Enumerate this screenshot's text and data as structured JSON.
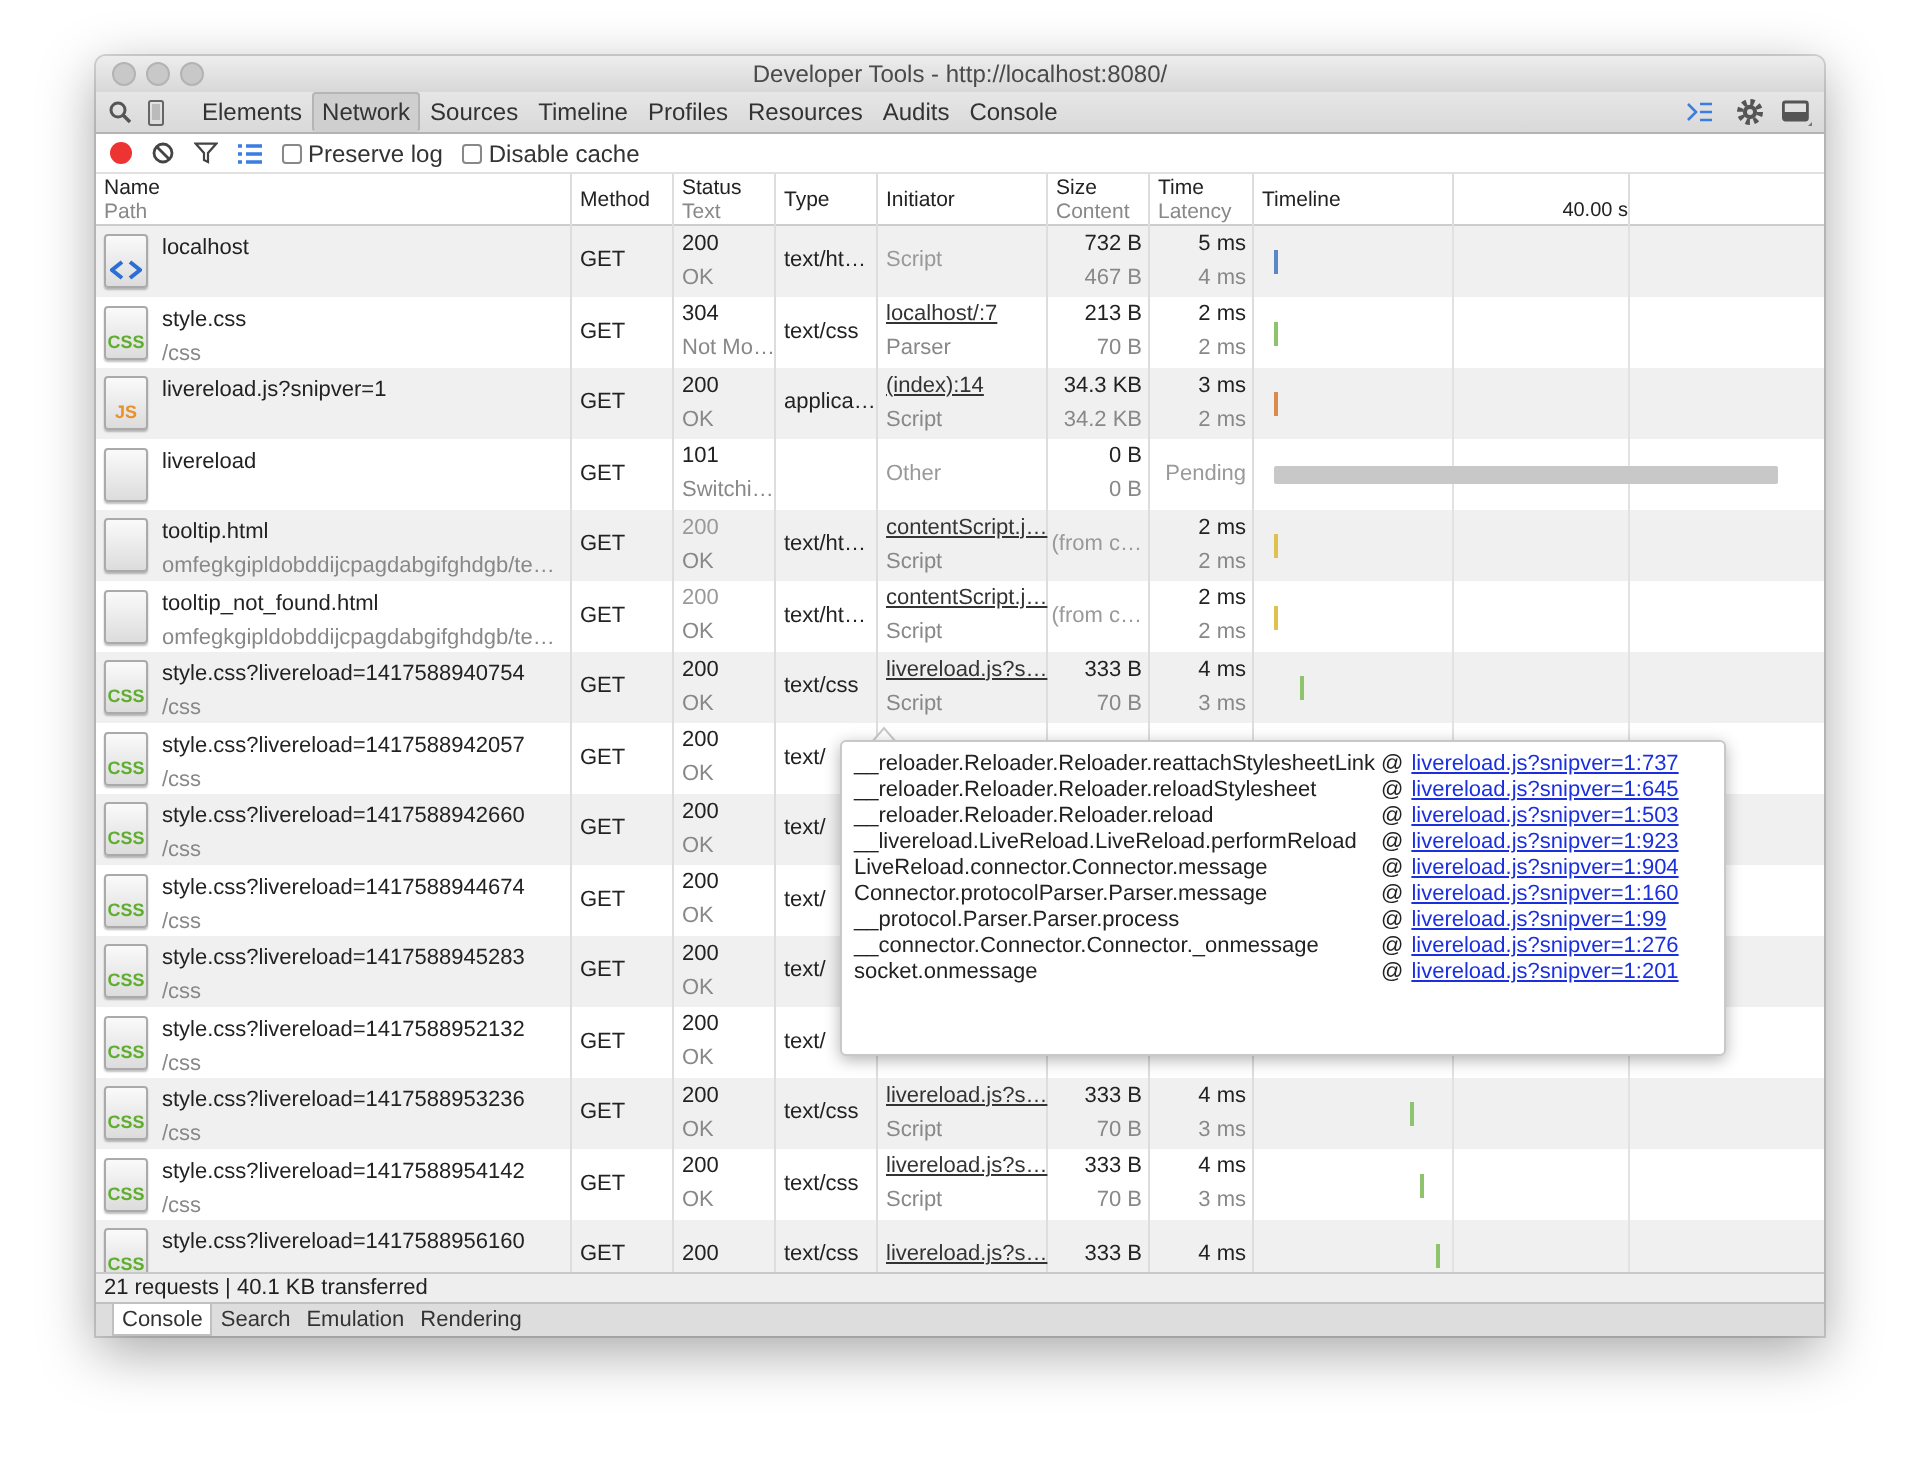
{
  "window": {
    "title": "Developer Tools - http://localhost:8080/"
  },
  "panel_tabs": [
    {
      "label": "Elements",
      "selected": false
    },
    {
      "label": "Network",
      "selected": true
    },
    {
      "label": "Sources",
      "selected": false
    },
    {
      "label": "Timeline",
      "selected": false
    },
    {
      "label": "Profiles",
      "selected": false
    },
    {
      "label": "Resources",
      "selected": false
    },
    {
      "label": "Audits",
      "selected": false
    },
    {
      "label": "Console",
      "selected": false
    }
  ],
  "toolbar": {
    "recording": true,
    "options": [
      {
        "label": "Preserve log",
        "checked": false
      },
      {
        "label": "Disable cache",
        "checked": false
      }
    ]
  },
  "columns": [
    {
      "top": "Name",
      "bottom": "Path"
    },
    {
      "top": "Method"
    },
    {
      "top": "Status",
      "bottom": "Text"
    },
    {
      "top": "Type"
    },
    {
      "top": "Initiator"
    },
    {
      "top": "Size",
      "bottom": "Content"
    },
    {
      "top": "Time",
      "bottom": "Latency"
    },
    {
      "top": "Timeline"
    }
  ],
  "timeline_scale": "40.00 s",
  "rows": [
    {
      "icon": {
        "kind": "html"
      },
      "name": "localhost",
      "method": "GET",
      "status": "200",
      "status_text": "OK",
      "from_cache": false,
      "type": "text/ht…",
      "initiator": "Script",
      "initiator_link": false,
      "size": "732 B",
      "content": "467 B",
      "time": "5 ms",
      "latency": "4 ms",
      "timeline": {
        "kind": "tick",
        "color": "#5b86c8"
      }
    },
    {
      "icon": {
        "kind": "css",
        "label": "CSS"
      },
      "name": "style.css",
      "path": "/css",
      "method": "GET",
      "status": "304",
      "status_text": "Not Mo…",
      "from_cache": false,
      "type": "text/css",
      "initiator": "localhost/:7",
      "initiator_link": true,
      "initiator_sub": "Parser",
      "size": "213 B",
      "content": "70 B",
      "time": "2 ms",
      "latency": "2 ms",
      "timeline": {
        "kind": "tick",
        "color": "#8fc46f"
      }
    },
    {
      "icon": {
        "kind": "js",
        "label": "JS"
      },
      "name": "livereload.js?snipver=1",
      "method": "GET",
      "status": "200",
      "status_text": "OK",
      "from_cache": false,
      "type": "applica…",
      "initiator": "(index):14",
      "initiator_link": true,
      "initiator_sub": "Script",
      "size": "34.3 KB",
      "content": "34.2 KB",
      "time": "3 ms",
      "latency": "2 ms",
      "timeline": {
        "kind": "tick",
        "color": "#d98c4e"
      }
    },
    {
      "icon": {
        "kind": "blank"
      },
      "name": "livereload",
      "method": "GET",
      "status": "101",
      "status_text": "Switchi…",
      "from_cache": false,
      "initiator": "Other",
      "initiator_link": false,
      "size": "0 B",
      "content": "0 B",
      "time": "Pending",
      "timeline": {
        "kind": "bar",
        "color": "#c8c8c8",
        "level": 0.92
      }
    },
    {
      "icon": {
        "kind": "blank"
      },
      "name": "tooltip.html",
      "path": "omfegkgipldobddijcpagdabgifghdgb/te…",
      "method": "GET",
      "status": "200",
      "status_text": "OK",
      "from_cache": true,
      "type": "text/ht…",
      "initiator": "contentScript.j…",
      "initiator_link": true,
      "initiator_sub": "Script",
      "size": "(from c…",
      "time": "2 ms",
      "latency": "2 ms",
      "timeline": {
        "kind": "tick",
        "color": "#e0c04e"
      }
    },
    {
      "icon": {
        "kind": "blank"
      },
      "name": "tooltip_not_found.html",
      "path": "omfegkgipldobddijcpagdabgifghdgb/te…",
      "method": "GET",
      "status": "200",
      "status_text": "OK",
      "from_cache": true,
      "type": "text/ht…",
      "initiator": "contentScript.j…",
      "initiator_link": true,
      "initiator_sub": "Script",
      "size": "(from c…",
      "time": "2 ms",
      "latency": "2 ms",
      "timeline": {
        "kind": "tick",
        "color": "#e0c04e"
      }
    },
    {
      "icon": {
        "kind": "css",
        "label": "CSS"
      },
      "name": "style.css?livereload=1417588940754",
      "path": "/css",
      "method": "GET",
      "status": "200",
      "status_text": "OK",
      "from_cache": false,
      "type": "text/css",
      "initiator": "livereload.js?s…",
      "initiator_link": true,
      "initiator_sub": "Script",
      "size": "333 B",
      "content": "70 B",
      "time": "4 ms",
      "latency": "3 ms",
      "timeline": {
        "kind": "tick",
        "color": "#8fc46f"
      }
    },
    {
      "icon": {
        "kind": "css",
        "label": "CSS"
      },
      "name": "style.css?livereload=1417588942057",
      "path": "/css",
      "method": "GET",
      "status": "200",
      "status_text": "OK",
      "from_cache": false,
      "type": "text/"
    },
    {
      "icon": {
        "kind": "css",
        "label": "CSS"
      },
      "name": "style.css?livereload=1417588942660",
      "path": "/css",
      "method": "GET",
      "status": "200",
      "status_text": "OK",
      "from_cache": false,
      "type": "text/"
    },
    {
      "icon": {
        "kind": "css",
        "label": "CSS"
      },
      "name": "style.css?livereload=1417588944674",
      "path": "/css",
      "method": "GET",
      "status": "200",
      "status_text": "OK",
      "from_cache": false,
      "type": "text/"
    },
    {
      "icon": {
        "kind": "css",
        "label": "CSS"
      },
      "name": "style.css?livereload=1417588945283",
      "path": "/css",
      "method": "GET",
      "status": "200",
      "status_text": "OK",
      "from_cache": false,
      "type": "text/"
    },
    {
      "icon": {
        "kind": "css",
        "label": "CSS"
      },
      "name": "style.css?livereload=1417588952132",
      "path": "/css",
      "method": "GET",
      "status": "200",
      "status_text": "OK",
      "from_cache": false,
      "type": "text/"
    },
    {
      "icon": {
        "kind": "css",
        "label": "CSS"
      },
      "name": "style.css?livereload=1417588953236",
      "path": "/css",
      "method": "GET",
      "status": "200",
      "status_text": "OK",
      "from_cache": false,
      "type": "text/css",
      "initiator": "livereload.js?s…",
      "initiator_link": true,
      "initiator_sub": "Script",
      "size": "333 B",
      "content": "70 B",
      "time": "4 ms",
      "latency": "3 ms",
      "timeline": {
        "kind": "tick",
        "color": "#8fc46f"
      }
    },
    {
      "icon": {
        "kind": "css",
        "label": "CSS"
      },
      "name": "style.css?livereload=1417588954142",
      "path": "/css",
      "method": "GET",
      "status": "200",
      "status_text": "OK",
      "from_cache": false,
      "type": "text/css",
      "initiator": "livereload.js?s…",
      "initiator_link": true,
      "initiator_sub": "Script",
      "size": "333 B",
      "content": "70 B",
      "time": "4 ms",
      "latency": "3 ms",
      "timeline": {
        "kind": "tick",
        "color": "#8fc46f"
      }
    },
    {
      "icon": {
        "kind": "css",
        "label": "CSS"
      },
      "name": "style.css?livereload=1417588956160",
      "method": "GET",
      "status": "200",
      "from_cache": false,
      "type": "text/css",
      "initiator": "livereload.js?s…",
      "initiator_link": true,
      "size": "333 B",
      "time": "4 ms",
      "timeline": {
        "kind": "tick",
        "color": "#8fc46f"
      }
    }
  ],
  "stack_popover": {
    "frames": [
      {
        "function": "__reloader.Reloader.Reloader.reattachStylesheetLink",
        "at": "@",
        "location": "livereload.js?snipver=1:737"
      },
      {
        "function": "__reloader.Reloader.Reloader.reloadStylesheet",
        "at": "@",
        "location": "livereload.js?snipver=1:645"
      },
      {
        "function": "__reloader.Reloader.Reloader.reload",
        "at": "@",
        "location": "livereload.js?snipver=1:503"
      },
      {
        "function": "__livereload.LiveReload.LiveReload.performReload",
        "at": "@",
        "location": "livereload.js?snipver=1:923"
      },
      {
        "function": "LiveReload.connector.Connector.message",
        "at": "@",
        "location": "livereload.js?snipver=1:904"
      },
      {
        "function": "Connector.protocolParser.Parser.message",
        "at": "@",
        "location": "livereload.js?snipver=1:160"
      },
      {
        "function": "__protocol.Parser.Parser.process",
        "at": "@",
        "location": "livereload.js?snipver=1:99"
      },
      {
        "function": "__connector.Connector.Connector._onmessage",
        "at": "@",
        "location": "livereload.js?snipver=1:276"
      },
      {
        "function": "socket.onmessage",
        "at": "@",
        "location": "livereload.js?snipver=1:201"
      }
    ]
  },
  "status_bar": "21 requests | 40.1 KB transferred",
  "drawer_tabs": [
    {
      "label": "Console",
      "selected": true
    },
    {
      "label": "Search",
      "selected": false
    },
    {
      "label": "Emulation",
      "selected": false
    },
    {
      "label": "Rendering",
      "selected": false
    }
  ]
}
